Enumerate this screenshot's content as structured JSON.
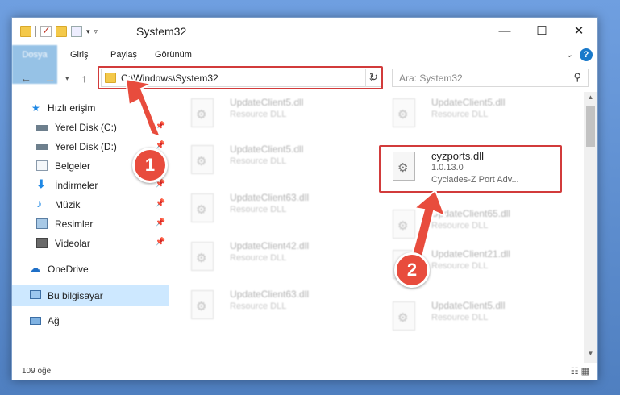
{
  "window": {
    "title": "System32",
    "minimize": "—",
    "maximize": "☐",
    "close": "✕"
  },
  "ribbon": {
    "tabs": [
      "Dosya",
      "Giriş",
      "Paylaş",
      "Görünüm"
    ],
    "help": "?"
  },
  "address": {
    "path": "C:\\Windows\\System32",
    "search_placeholder": "Ara: System32"
  },
  "sidebar": {
    "items": [
      {
        "label": "Hızlı erişim",
        "icon": "star-icon",
        "pinned": false
      },
      {
        "label": "Yerel Disk (C:)",
        "icon": "drive-icon",
        "pinned": true
      },
      {
        "label": "Yerel Disk (D:)",
        "icon": "drive-icon",
        "pinned": true
      },
      {
        "label": "Belgeler",
        "icon": "documents-icon",
        "pinned": true
      },
      {
        "label": "İndirmeler",
        "icon": "download-icon",
        "pinned": true
      },
      {
        "label": "Müzik",
        "icon": "music-icon",
        "pinned": true
      },
      {
        "label": "Resimler",
        "icon": "pictures-icon",
        "pinned": true
      },
      {
        "label": "Videolar",
        "icon": "videos-icon",
        "pinned": true
      },
      {
        "label": "OneDrive",
        "icon": "cloud-icon",
        "pinned": false
      },
      {
        "label": "Bu bilgisayar",
        "icon": "computer-icon",
        "pinned": false
      },
      {
        "label": "Ağ",
        "icon": "network-icon",
        "pinned": false
      }
    ]
  },
  "files": {
    "left": [
      {
        "name": "UpdateClient5.dll",
        "type": "Resource DLL"
      },
      {
        "name": "UpdateClient5.dll",
        "type": "Resource DLL"
      },
      {
        "name": "UpdateClient63.dll",
        "type": "Resource DLL"
      },
      {
        "name": "UpdateClient42.dll",
        "type": "Resource DLL"
      },
      {
        "name": "UpdateClient63.dll",
        "type": "Resource DLL"
      }
    ],
    "right": [
      {
        "name": "UpdateClient5.dll",
        "type": "Resource DLL"
      },
      {
        "name": "UpdateClient65.dll",
        "type": "Resource DLL"
      },
      {
        "name": "UpdateClient21.dll",
        "type": "Resource DLL"
      },
      {
        "name": "UpdateClient5.dll",
        "type": "Resource DLL"
      }
    ],
    "highlighted": {
      "name": "cyzports.dll",
      "version": "1.0.13.0",
      "description": "Cyclades-Z Port Adv..."
    }
  },
  "status": {
    "count": "109 öğe"
  },
  "annotations": {
    "badge1": "1",
    "badge2": "2",
    "color": "#e84c3d"
  }
}
